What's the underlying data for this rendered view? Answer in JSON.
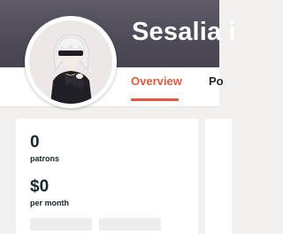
{
  "creator": {
    "name": "Sesalia i"
  },
  "tabs": [
    {
      "label": "Overview",
      "active": true
    },
    {
      "label": "Po",
      "active": false
    }
  ],
  "stats": [
    {
      "value": "0",
      "label": "patrons"
    },
    {
      "value": "$0",
      "label": "per month"
    }
  ],
  "colors": {
    "accent": "#e05a41",
    "banner": "#4f4a58",
    "text_dark": "#17262f",
    "page_bg": "#f1f0ef"
  },
  "icons": {
    "avatar": "anime-character-avatar"
  }
}
